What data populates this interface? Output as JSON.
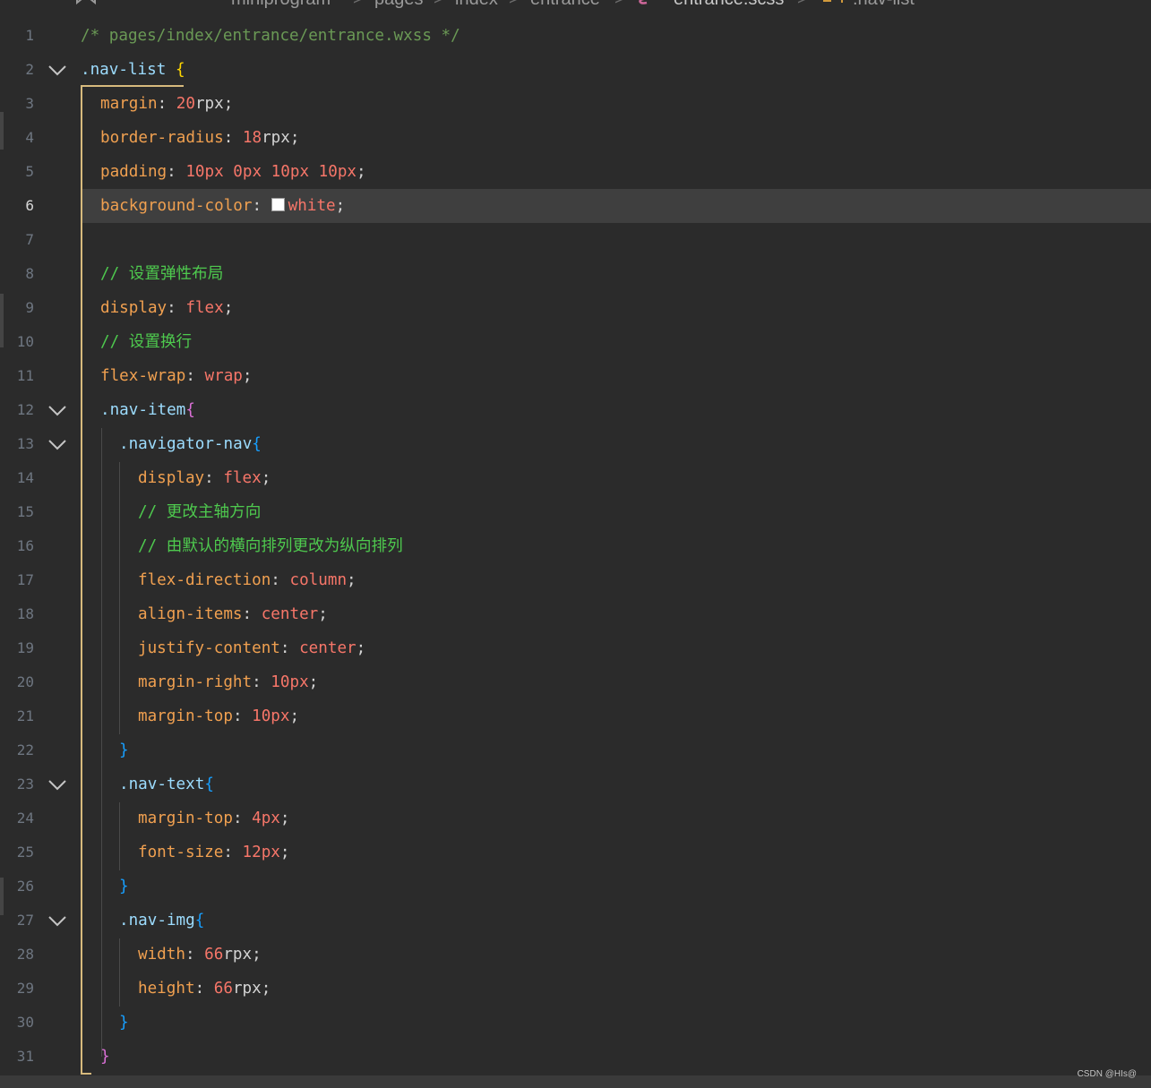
{
  "breadcrumb": {
    "items": [
      "miniprogram",
      "pages",
      "index",
      "entrance",
      "entrance.scss",
      ".nav-list"
    ],
    "separator": ">"
  },
  "editor": {
    "current_line": 6,
    "lines": [
      {
        "n": "1",
        "tokens": [
          {
            "t": "/* pages/index/entrance/entrance.wxss */",
            "c": "comment"
          }
        ]
      },
      {
        "n": "2",
        "fold": true,
        "tokens": [
          {
            "t": ".nav-list ",
            "c": "sel"
          },
          {
            "t": "{",
            "c": "brace-y"
          }
        ]
      },
      {
        "n": "3",
        "tokens": [
          {
            "t": "margin",
            "c": "prop"
          },
          {
            "t": ": ",
            "c": "pun"
          },
          {
            "t": "20",
            "c": "num"
          },
          {
            "t": "rpx",
            "c": "unit"
          },
          {
            "t": ";",
            "c": "pun"
          }
        ]
      },
      {
        "n": "4",
        "tokens": [
          {
            "t": "border-radius",
            "c": "prop"
          },
          {
            "t": ": ",
            "c": "pun"
          },
          {
            "t": "18",
            "c": "num"
          },
          {
            "t": "rpx",
            "c": "unit"
          },
          {
            "t": ";",
            "c": "pun"
          }
        ]
      },
      {
        "n": "5",
        "tokens": [
          {
            "t": "padding",
            "c": "prop"
          },
          {
            "t": ": ",
            "c": "pun"
          },
          {
            "t": "10px 0px 10px 10px",
            "c": "num"
          },
          {
            "t": ";",
            "c": "pun"
          }
        ]
      },
      {
        "n": "6",
        "tokens": [
          {
            "t": "background-color",
            "c": "prop"
          },
          {
            "t": ": ",
            "c": "pun"
          },
          {
            "t": "",
            "c": "swatch"
          },
          {
            "t": "white",
            "c": "val"
          },
          {
            "t": ";",
            "c": "pun"
          }
        ]
      },
      {
        "n": "7",
        "tokens": []
      },
      {
        "n": "8",
        "tokens": [
          {
            "t": "// 设置弹性布局",
            "c": "comment-zh"
          }
        ]
      },
      {
        "n": "9",
        "tokens": [
          {
            "t": "display",
            "c": "prop"
          },
          {
            "t": ": ",
            "c": "pun"
          },
          {
            "t": "flex",
            "c": "val"
          },
          {
            "t": ";",
            "c": "pun"
          }
        ]
      },
      {
        "n": "10",
        "tokens": [
          {
            "t": "// 设置换行",
            "c": "comment-zh"
          }
        ]
      },
      {
        "n": "11",
        "tokens": [
          {
            "t": "flex-wrap",
            "c": "prop"
          },
          {
            "t": ": ",
            "c": "pun"
          },
          {
            "t": "wrap",
            "c": "val"
          },
          {
            "t": ";",
            "c": "pun"
          }
        ]
      },
      {
        "n": "12",
        "fold": true,
        "tokens": [
          {
            "t": ".nav-item",
            "c": "sel"
          },
          {
            "t": "{",
            "c": "brace-p"
          }
        ]
      },
      {
        "n": "13",
        "fold": true,
        "tokens": [
          {
            "t": ".navigator-nav",
            "c": "sel"
          },
          {
            "t": "{",
            "c": "brace-b"
          }
        ]
      },
      {
        "n": "14",
        "tokens": [
          {
            "t": "display",
            "c": "prop"
          },
          {
            "t": ": ",
            "c": "pun"
          },
          {
            "t": "flex",
            "c": "val"
          },
          {
            "t": ";",
            "c": "pun"
          }
        ]
      },
      {
        "n": "15",
        "tokens": [
          {
            "t": "// 更改主轴方向",
            "c": "comment-zh"
          }
        ]
      },
      {
        "n": "16",
        "tokens": [
          {
            "t": "// 由默认的横向排列更改为纵向排列",
            "c": "comment-zh"
          }
        ]
      },
      {
        "n": "17",
        "tokens": [
          {
            "t": "flex-direction",
            "c": "prop"
          },
          {
            "t": ": ",
            "c": "pun"
          },
          {
            "t": "column",
            "c": "val"
          },
          {
            "t": ";",
            "c": "pun"
          }
        ]
      },
      {
        "n": "18",
        "tokens": [
          {
            "t": "align-items",
            "c": "prop"
          },
          {
            "t": ": ",
            "c": "pun"
          },
          {
            "t": "center",
            "c": "val"
          },
          {
            "t": ";",
            "c": "pun"
          }
        ]
      },
      {
        "n": "19",
        "tokens": [
          {
            "t": "justify-content",
            "c": "prop"
          },
          {
            "t": ": ",
            "c": "pun"
          },
          {
            "t": "center",
            "c": "val"
          },
          {
            "t": ";",
            "c": "pun"
          }
        ]
      },
      {
        "n": "20",
        "tokens": [
          {
            "t": "margin-right",
            "c": "prop"
          },
          {
            "t": ": ",
            "c": "pun"
          },
          {
            "t": "10px",
            "c": "num"
          },
          {
            "t": ";",
            "c": "pun"
          }
        ]
      },
      {
        "n": "21",
        "tokens": [
          {
            "t": "margin-top",
            "c": "prop"
          },
          {
            "t": ": ",
            "c": "pun"
          },
          {
            "t": "10px",
            "c": "num"
          },
          {
            "t": ";",
            "c": "pun"
          }
        ]
      },
      {
        "n": "22",
        "tokens": [
          {
            "t": "}",
            "c": "brace-b"
          }
        ]
      },
      {
        "n": "23",
        "fold": true,
        "tokens": [
          {
            "t": ".nav-text",
            "c": "sel"
          },
          {
            "t": "{",
            "c": "brace-b"
          }
        ]
      },
      {
        "n": "24",
        "tokens": [
          {
            "t": "margin-top",
            "c": "prop"
          },
          {
            "t": ": ",
            "c": "pun"
          },
          {
            "t": "4px",
            "c": "num"
          },
          {
            "t": ";",
            "c": "pun"
          }
        ]
      },
      {
        "n": "25",
        "tokens": [
          {
            "t": "font-size",
            "c": "prop"
          },
          {
            "t": ": ",
            "c": "pun"
          },
          {
            "t": "12px",
            "c": "num"
          },
          {
            "t": ";",
            "c": "pun"
          }
        ]
      },
      {
        "n": "26",
        "tokens": [
          {
            "t": "}",
            "c": "brace-b"
          }
        ]
      },
      {
        "n": "27",
        "fold": true,
        "tokens": [
          {
            "t": ".nav-img",
            "c": "sel"
          },
          {
            "t": "{",
            "c": "brace-b"
          }
        ]
      },
      {
        "n": "28",
        "tokens": [
          {
            "t": "width",
            "c": "prop"
          },
          {
            "t": ": ",
            "c": "pun"
          },
          {
            "t": "66",
            "c": "num"
          },
          {
            "t": "rpx",
            "c": "unit"
          },
          {
            "t": ";",
            "c": "pun"
          }
        ]
      },
      {
        "n": "29",
        "tokens": [
          {
            "t": "height",
            "c": "prop"
          },
          {
            "t": ": ",
            "c": "pun"
          },
          {
            "t": "66",
            "c": "num"
          },
          {
            "t": "rpx",
            "c": "unit"
          },
          {
            "t": ";",
            "c": "pun"
          }
        ]
      },
      {
        "n": "30",
        "tokens": [
          {
            "t": "}",
            "c": "brace-b"
          }
        ]
      },
      {
        "n": "31",
        "tokens": [
          {
            "t": "}",
            "c": "brace-p"
          }
        ]
      }
    ]
  },
  "watermark": "CSDN @HIs@"
}
